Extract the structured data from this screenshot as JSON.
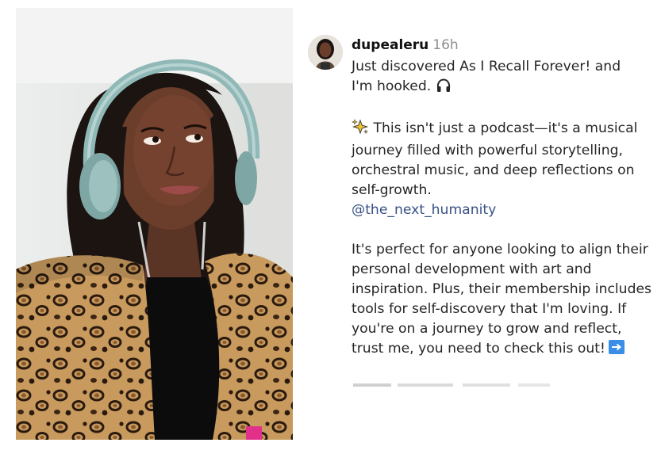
{
  "post": {
    "username": "dupealeru",
    "time": "16h",
    "line1": "Just discovered As I Recall Forever! and",
    "line2": "I'm hooked.",
    "para2": "This isn't just a podcast—it's a musical journey filled with powerful storytelling, orchestral music, and deep reflections on self-growth.",
    "mention": "@the_next_humanity",
    "para3": "It's perfect for anyone looking to align their personal development with art and inspiration. Plus, their membership includes tools for self-discovery that I'm loving. If you're on a journey to grow and reflect, trust me, you need to check this out!"
  },
  "icons": {
    "headphones": "headphones-icon",
    "sparkles": "sparkles-icon",
    "arrow": "right-arrow-icon"
  },
  "colors": {
    "mention": "#385185",
    "arrow_badge": "#3b8ee6",
    "leopard_base": "#c89a5e",
    "headphones": "#8fb8b6"
  }
}
